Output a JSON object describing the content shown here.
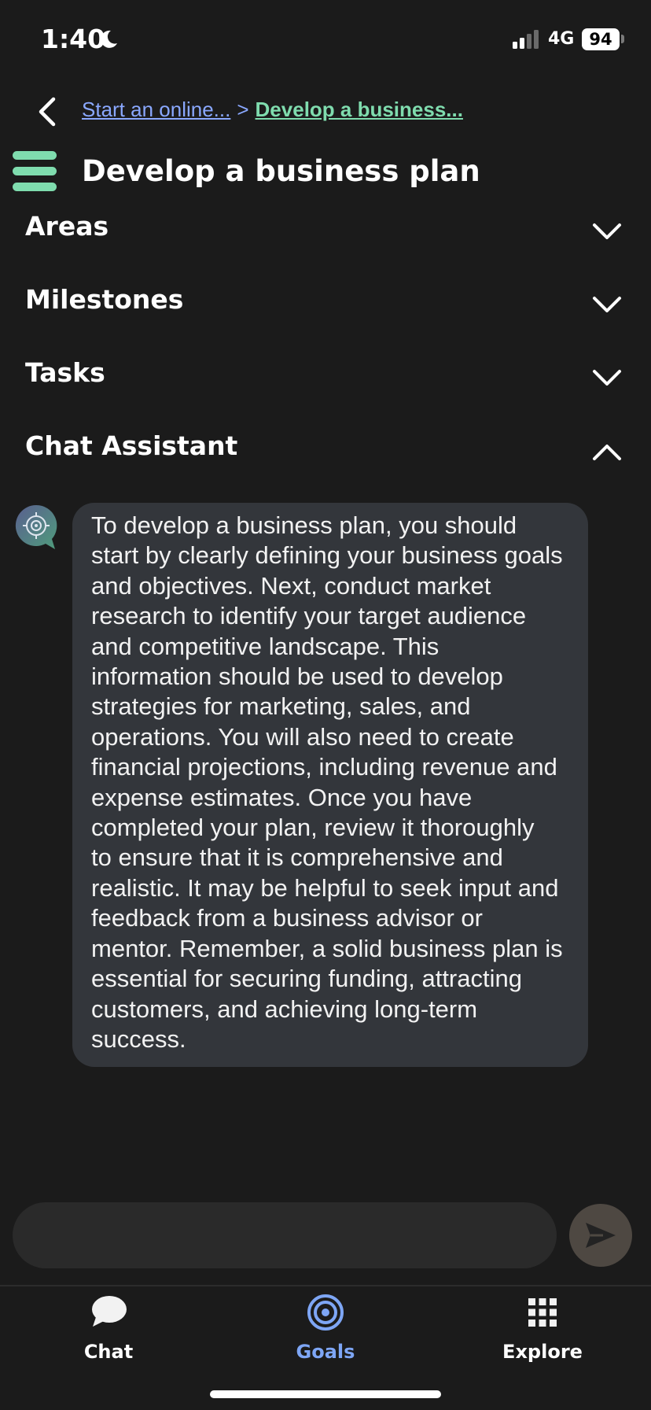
{
  "status_bar": {
    "time": "1:40",
    "network": "4G",
    "battery": "94"
  },
  "breadcrumb": {
    "parent": "Start an online...",
    "separator": ">",
    "current": "Develop a business..."
  },
  "header": {
    "title": "Develop a business plan"
  },
  "sections": [
    {
      "label": "Areas",
      "expanded": false
    },
    {
      "label": "Milestones",
      "expanded": false
    },
    {
      "label": "Tasks",
      "expanded": false
    },
    {
      "label": "Chat Assistant",
      "expanded": true
    }
  ],
  "chat": {
    "messages": [
      {
        "sender": "assistant",
        "lines": [
          "To develop a business plan, you should",
          "start by clearly defining your business goals",
          "and objectives. Next, conduct market",
          "research to identify your target audience",
          "and competitive landscape. This",
          "information should be used to develop",
          "strategies for marketing, sales, and",
          "operations. You will also need to create",
          "financial projections, including revenue and",
          "expense estimates. Once you have",
          "completed your plan, review it thoroughly",
          "to ensure that it is comprehensive and",
          "realistic. It may be helpful to seek input and",
          "feedback from a business advisor or",
          "mentor. Remember, a solid business plan is",
          "essential for securing funding, attracting",
          "customers, and achieving long-term",
          "success."
        ]
      }
    ],
    "input_value": "",
    "input_placeholder": ""
  },
  "bottom_nav": {
    "items": [
      {
        "label": "Chat",
        "icon": "chat-bubble-icon",
        "active": false
      },
      {
        "label": "Goals",
        "icon": "target-icon",
        "active": true
      },
      {
        "label": "Explore",
        "icon": "grid-icon",
        "active": false
      }
    ]
  },
  "colors": {
    "background": "#1b1b1b",
    "accent_green": "#7fdcae",
    "link_blue": "#8aa8ff",
    "active_nav": "#7ea6f5",
    "bubble": "#33363b"
  }
}
